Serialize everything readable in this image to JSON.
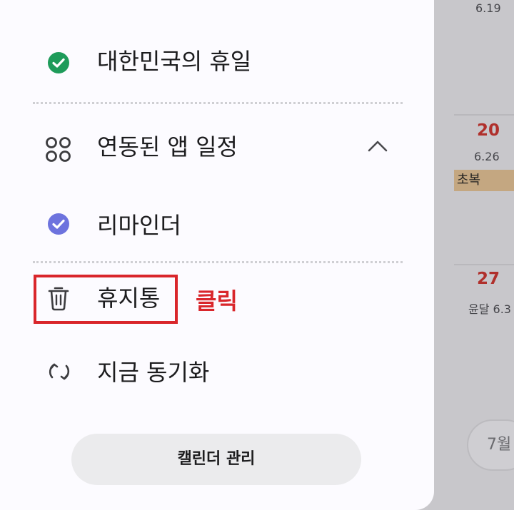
{
  "calendar": {
    "top_lunar": "6.19",
    "week2": {
      "day": "20",
      "lunar": "6.26",
      "event": "초복"
    },
    "week3": {
      "day": "27",
      "lunar": "윤달 6.3"
    },
    "month_button": "7월",
    "colors": {
      "sunday": "#b0302c",
      "event_bg": "#c4a781"
    }
  },
  "drawer": {
    "items": [
      {
        "label": "대한민국의 휴일",
        "icon": "check-circle-green-icon"
      },
      {
        "label": "연동된 앱 일정",
        "icon": "apps-grid-icon",
        "expand_icon": "chevron-up-icon"
      },
      {
        "label": "리마인더",
        "icon": "check-circle-purple-icon"
      },
      {
        "label": "휴지통",
        "icon": "trash-icon"
      },
      {
        "label": "지금 동기화",
        "icon": "sync-icon"
      }
    ],
    "manage_button": "캘린더 관리",
    "colors": {
      "holiday_check": "#1e9b5a",
      "reminder_check": "#6d73de"
    }
  },
  "annotation": {
    "note": "클릭",
    "color": "#d9262b"
  }
}
